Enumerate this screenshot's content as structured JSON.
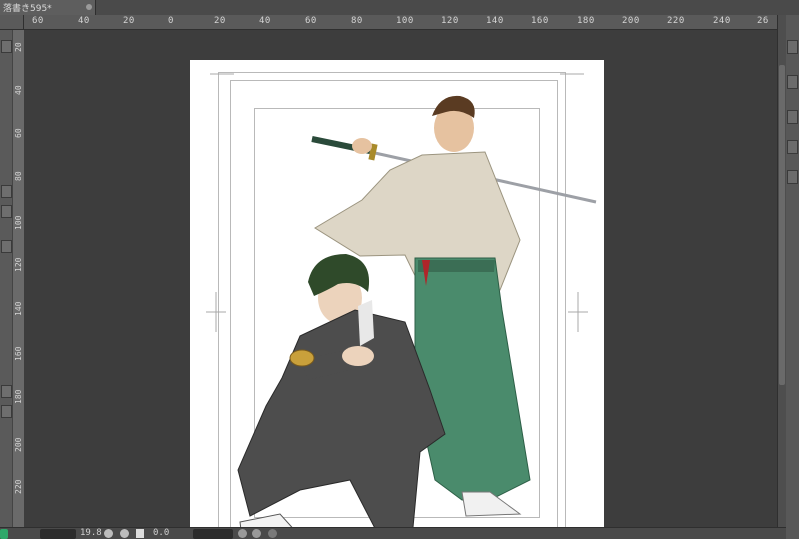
{
  "document": {
    "tab_title": "落書き595*"
  },
  "rulers": {
    "top_ticks": [
      "60",
      "40",
      "20",
      "0",
      "20",
      "40",
      "60",
      "80",
      "100",
      "120",
      "140",
      "160",
      "180",
      "200",
      "220",
      "240",
      "26"
    ],
    "left_ticks": [
      "20",
      "40",
      "60",
      "80",
      "100",
      "120",
      "140",
      "160",
      "180",
      "200",
      "220"
    ]
  },
  "status": {
    "zoom": "19.8",
    "angle": "0.0"
  },
  "icons": {
    "tab_close": "close-icon",
    "zoom_out": "zoom-out-icon",
    "zoom_in": "zoom-in-icon",
    "rotate": "rotate-icon"
  },
  "colors": {
    "workspace_bg": "#3d3d3d",
    "canvas_bg": "#ffffff",
    "ruler_bg": "#5a5a5a"
  },
  "artwork": {
    "subject": "illustration"
  }
}
